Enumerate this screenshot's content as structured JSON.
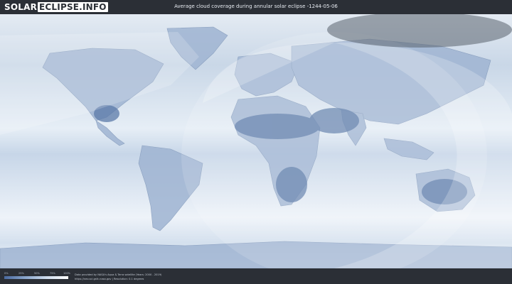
{
  "header": {
    "logo_part1": "SOLAR",
    "logo_part2": "ECLIPSE.INFO",
    "title": "Average cloud coverage during annular solar eclipse -1244-05-06"
  },
  "legend": {
    "ticks": [
      "0%",
      "25%",
      "50%",
      "75%",
      "100%"
    ],
    "colors": {
      "low": "#4a6aa0",
      "high": "#ffffff"
    }
  },
  "footer": {
    "credit_line1": "Data provided by NASA's Aqua & Terra satellite (Years: 2000 - 2019)",
    "credit_line2": "https://neo.sci.gsfc.nasa.gov | Resolution: 0.1 degrees"
  },
  "colors": {
    "background": "#2b2f36",
    "ocean_cloud": "#dce6f1",
    "clear_sky": "#5b7aa8",
    "visibility_overlay": "#ffffff"
  }
}
